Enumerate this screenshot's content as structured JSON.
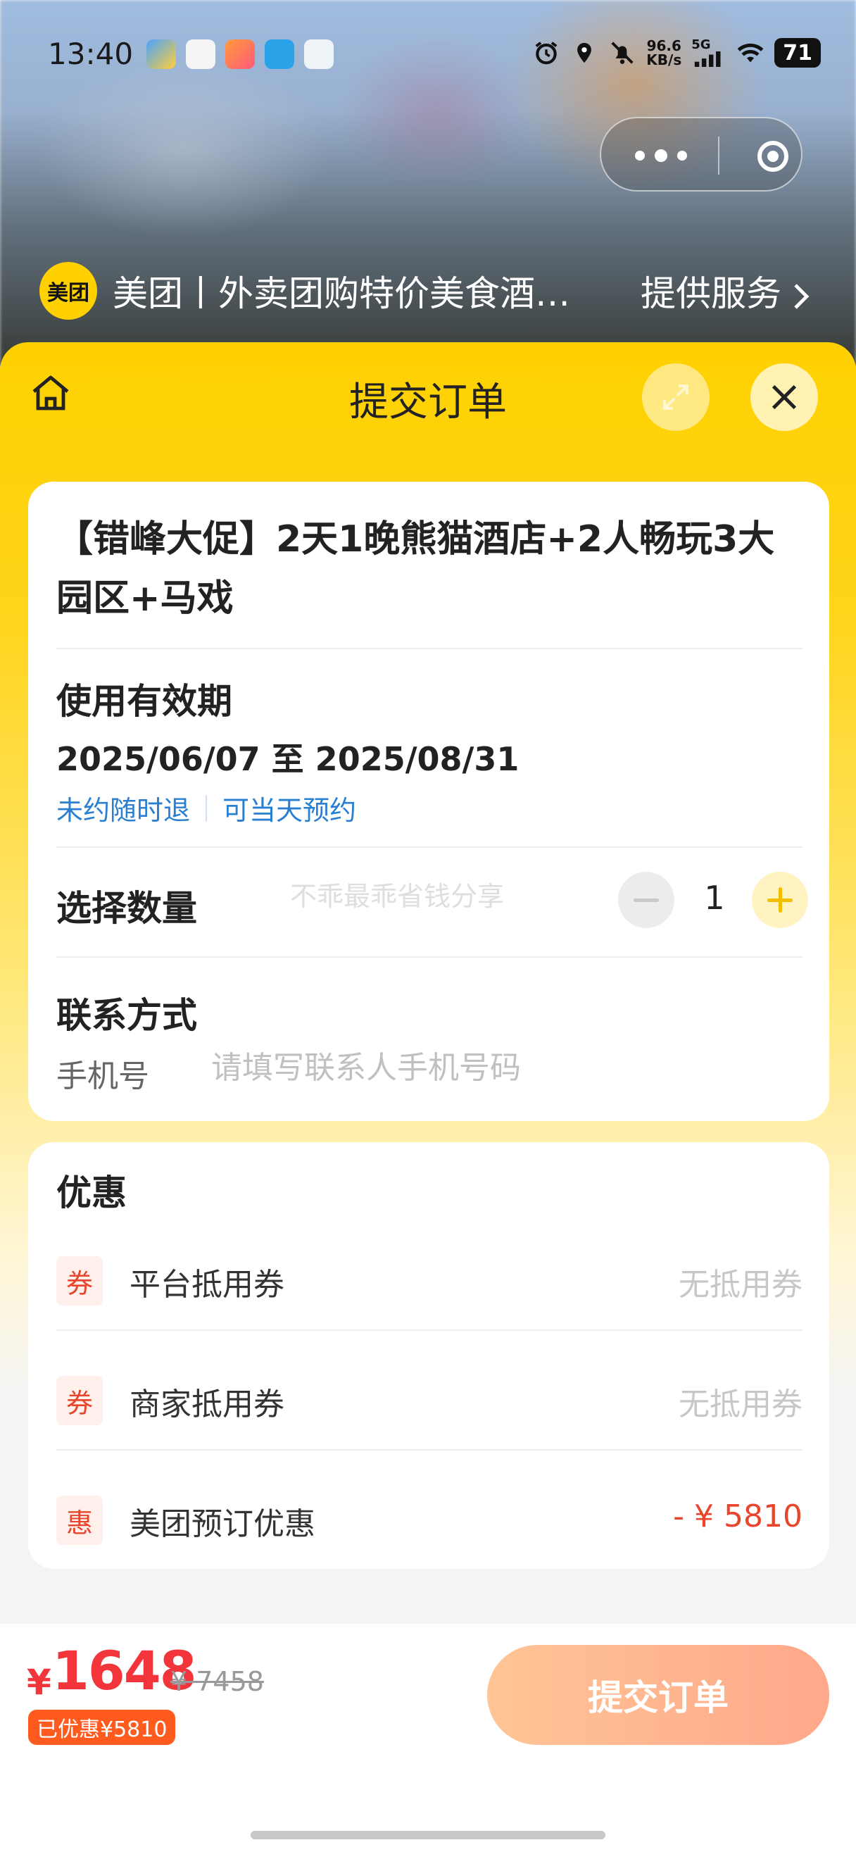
{
  "status_bar": {
    "time": "13:40",
    "net_speed_value": "96.6",
    "net_speed_unit": "KB/s",
    "signal": "5G",
    "battery": "71",
    "icons": [
      "alarm-icon",
      "location-icon",
      "mute-icon",
      "signal-icon",
      "wifi-icon"
    ]
  },
  "provider": {
    "logo_text": "美团",
    "name": "美团丨外卖团购特价美食酒…",
    "service_link": "提供服务"
  },
  "sheet": {
    "title": "提交订单"
  },
  "product": {
    "title": "【错峰大促】2天1晚熊猫酒店+2人畅玩3大园区+马戏"
  },
  "validity": {
    "label": "使用有效期",
    "range": "2025/06/07 至 2025/08/31",
    "tags": [
      "未约随时退",
      "可当天预约"
    ]
  },
  "quantity": {
    "label": "选择数量",
    "watermark": "不乖最乖省钱分享",
    "value": "1"
  },
  "contact": {
    "label": "联系方式",
    "phone_label": "手机号",
    "phone_placeholder": "请填写联系人手机号码"
  },
  "promo": {
    "title": "优惠",
    "rows": [
      {
        "badge": "券",
        "name": "平台抵用券",
        "value": "无抵用券"
      },
      {
        "badge": "券",
        "name": "商家抵用券",
        "value": "无抵用券"
      },
      {
        "badge": "惠",
        "name": "美团预订优惠",
        "value": "- ¥ 5810"
      }
    ]
  },
  "bottom": {
    "currency": "¥",
    "price": "1648",
    "original_price": "¥ 7458",
    "saved": "已优惠¥5810",
    "submit_label": "提交订单"
  },
  "colors": {
    "brand_yellow": "#ffd100",
    "price_red": "#f1353b",
    "link_blue": "#2a7fd0",
    "submit_gradient_start": "#ffc596",
    "submit_gradient_end": "#ffa88a"
  }
}
